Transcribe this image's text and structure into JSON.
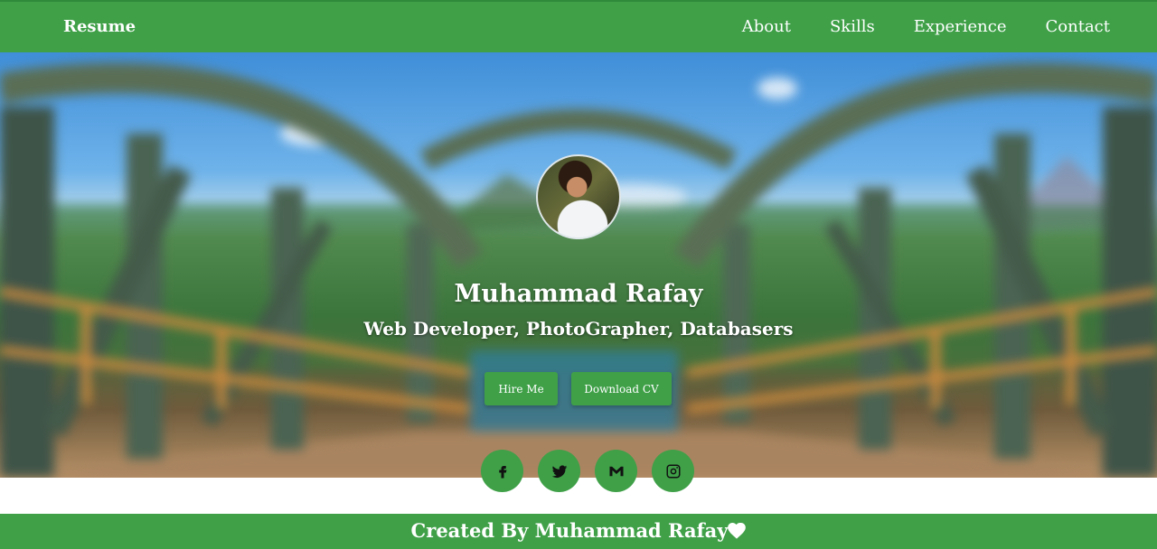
{
  "nav": {
    "brand": "Resume",
    "links": [
      "About",
      "Skills",
      "Experience",
      "Contact"
    ]
  },
  "hero": {
    "name": "Muhammad Rafay",
    "roles": "Web Developer, PhotoGrapher, Databasers",
    "buttons": {
      "hire": "Hire Me",
      "cv": "Download CV"
    }
  },
  "social": [
    "facebook-icon",
    "twitter-icon",
    "gmail-icon",
    "instagram-icon"
  ],
  "footer": {
    "text": "Created By Muhammad Rafay"
  },
  "colors": {
    "accent": "#3fa048",
    "text": "#ffffff"
  }
}
